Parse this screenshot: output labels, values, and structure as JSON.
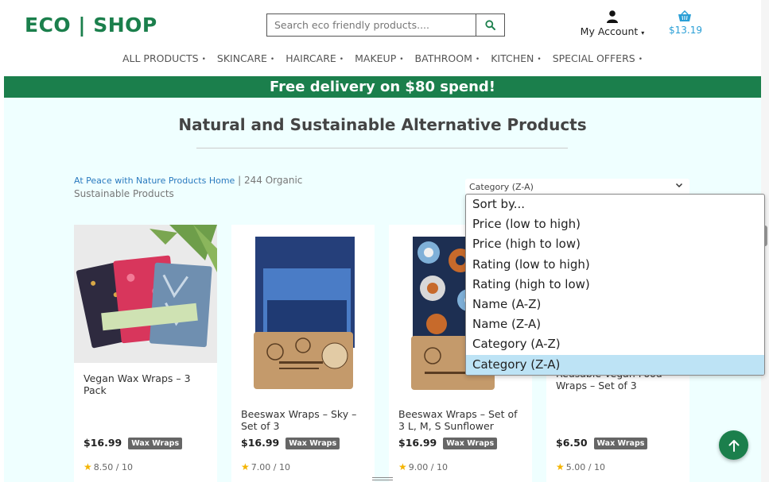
{
  "header": {
    "logo": "ECO | SHOP",
    "search_placeholder": "Search eco friendly products....",
    "account_label": "My Account",
    "account_caret": "▾",
    "cart_total": "$13.19"
  },
  "nav": {
    "items": [
      {
        "label": "ALL PRODUCTS"
      },
      {
        "label": "SKINCARE"
      },
      {
        "label": "HAIRCARE"
      },
      {
        "label": "MAKEUP"
      },
      {
        "label": "BATHROOM"
      },
      {
        "label": "KITCHEN"
      },
      {
        "label": "SPECIAL OFFERS"
      }
    ],
    "separator": "•"
  },
  "banner": {
    "text": "Free delivery on $80 spend!"
  },
  "main": {
    "heading": "Natural and Sustainable Alternative Products",
    "breadcrumb_link": "At Peace with Nature Products Home",
    "breadcrumb_rest": " | 244 Organic Sustainable Products"
  },
  "sort": {
    "selected": "Category (Z-A)",
    "options": [
      "Sort by...",
      "Price (low to high)",
      "Price (high to low)",
      "Rating (low to high)",
      "Rating (high to low)",
      "Name (A-Z)",
      "Name (Z-A)",
      "Category (A-Z)",
      "Category (Z-A)"
    ]
  },
  "products": [
    {
      "title": "Vegan Wax Wraps – 3 Pack",
      "price": "$16.99",
      "tag": "Wax Wraps",
      "rating": "8.50 / 10"
    },
    {
      "title": "Beeswax Wraps – Sky – Set of 3",
      "price": "$16.99",
      "tag": "Wax Wraps",
      "rating": "7.00 / 10"
    },
    {
      "title": "Beeswax Wraps – Set of 3 L, M, S Sunflower",
      "price": "$16.99",
      "tag": "Wax Wraps",
      "rating": "9.00 / 10"
    },
    {
      "title": "Reusable Vegan Food Wraps – Set of 3",
      "price": "$6.50",
      "tag": "Wax Wraps",
      "rating": "5.00 / 10"
    }
  ],
  "colors": {
    "brand": "#1b7f4c",
    "accent": "#2a9fd6",
    "page_bg": "#efffff"
  }
}
